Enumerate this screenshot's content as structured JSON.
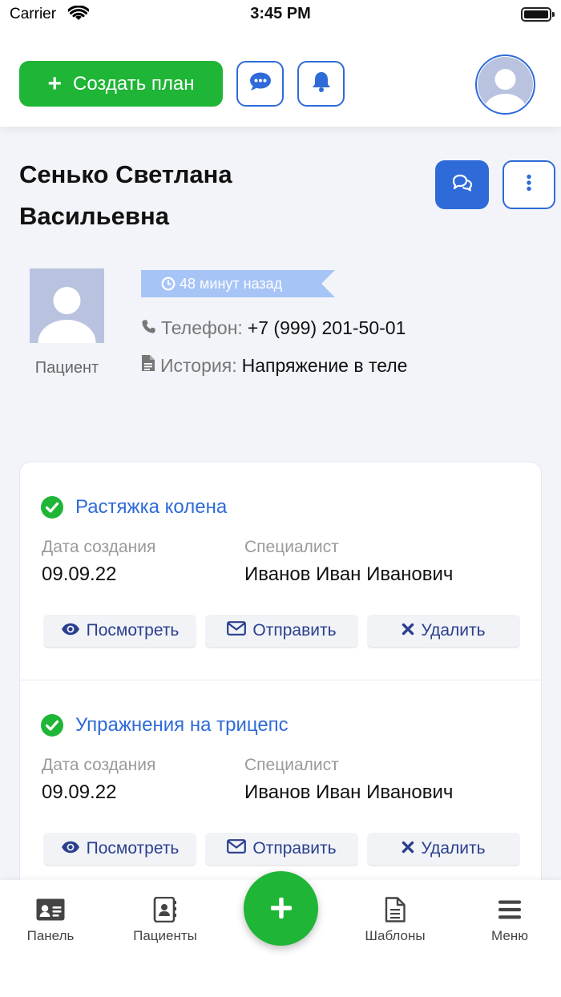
{
  "status_bar": {
    "carrier": "Carrier",
    "time": "3:45 PM"
  },
  "header": {
    "create_plan_label": "Создать план"
  },
  "patient": {
    "name_line1": "Сенько Светлана",
    "name_line2": "Васильевна",
    "role": "Пациент",
    "last_seen": "48 минут назад",
    "phone_label": "Телефон:",
    "phone_value": "+7 (999) 201-50-01",
    "history_label": "История:",
    "history_value": "Напряжение в теле"
  },
  "plans": [
    {
      "title": "Растяжка колена",
      "created_label": "Дата создания",
      "created_value": "09.09.22",
      "specialist_label": "Специалист",
      "specialist_value": "Иванов Иван Иванович",
      "view_label": "Посмотреть",
      "send_label": "Отправить",
      "delete_label": "Удалить"
    },
    {
      "title": "Упражнения на трицепс",
      "created_label": "Дата создания",
      "created_value": "09.09.22",
      "specialist_label": "Специалист",
      "specialist_value": "Иванов Иван Иванович",
      "view_label": "Посмотреть",
      "send_label": "Отправить",
      "delete_label": "Удалить"
    }
  ],
  "tabbar": {
    "panel": "Панель",
    "patients": "Пациенты",
    "templates": "Шаблоны",
    "menu": "Меню"
  },
  "colors": {
    "primary": "#2f6bd8",
    "success": "#1fb536",
    "ribbon": "#a7c4f7",
    "background": "#f2f4f9"
  },
  "icons": {
    "create_plan": "plus-icon",
    "messages": "chat-dots-icon",
    "notifications": "bell-icon",
    "patient_chat": "comments-icon",
    "more": "ellipsis-vertical-icon",
    "time": "clock-icon",
    "phone": "phone-icon",
    "history": "document-icon",
    "plan_status": "check-circle-icon",
    "view": "eye-icon",
    "send": "envelope-icon",
    "delete": "times-icon"
  }
}
